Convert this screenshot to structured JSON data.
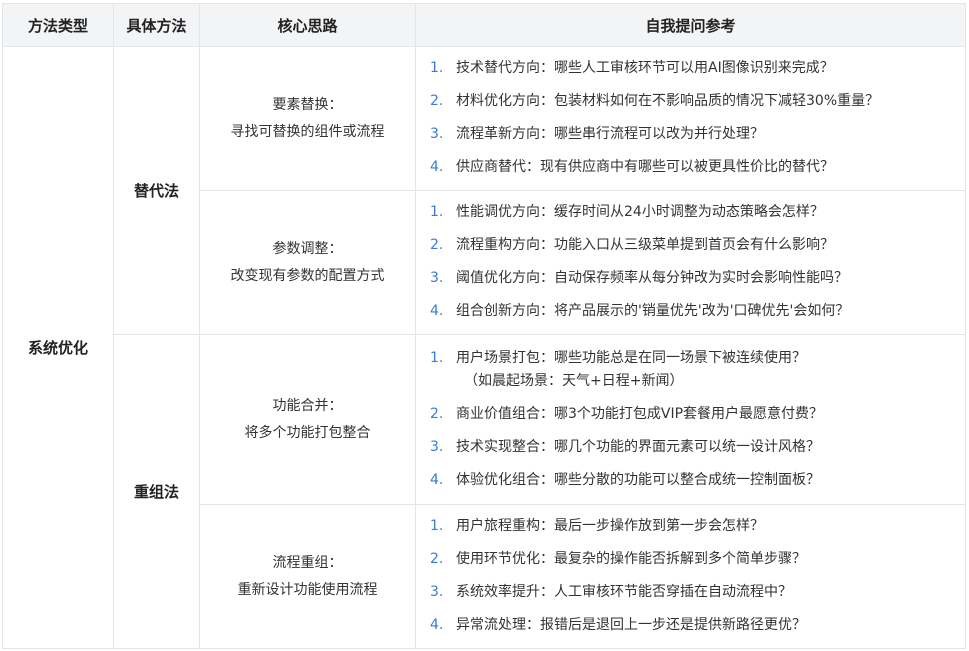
{
  "headers": [
    "方法类型",
    "具体方法",
    "核心思路",
    "自我提问参考"
  ],
  "category": "系统优化",
  "methods": [
    {
      "name": "替代法",
      "subs": [
        {
          "idea_title": "要素替换：",
          "idea_desc": "寻找可替换的组件或流程",
          "questions": [
            {
              "num": "1.",
              "text": "技术替代方向：哪些人工审核环节可以用AI图像识别来完成？"
            },
            {
              "num": "2.",
              "text": "材料优化方向：包装材料如何在不影响品质的情况下减轻30%重量？"
            },
            {
              "num": "3.",
              "text": "流程革新方向：哪些串行流程可以改为并行处理？"
            },
            {
              "num": "4.",
              "text": "供应商替代：现有供应商中有哪些可以被更具性价比的替代？"
            }
          ]
        },
        {
          "idea_title": "参数调整：",
          "idea_desc": "改变现有参数的配置方式",
          "questions": [
            {
              "num": "1.",
              "text": "性能调优方向：缓存时间从24小时调整为动态策略会怎样？"
            },
            {
              "num": "2.",
              "text": "流程重构方向：功能入口从三级菜单提到首页会有什么影响？"
            },
            {
              "num": "3.",
              "text": "阈值优化方向：自动保存频率从每分钟改为实时会影响性能吗？"
            },
            {
              "num": "4.",
              "text": "组合创新方向：将产品展示的'销量优先'改为'口碑优先'会如何？"
            }
          ]
        }
      ]
    },
    {
      "name": "重组法",
      "subs": [
        {
          "idea_title": "功能合并：",
          "idea_desc": "将多个功能打包整合",
          "questions": [
            {
              "num": "1.",
              "text": "用户场景打包：哪些功能总是在同一场景下被连续使用？",
              "sub": "（如晨起场景：天气+日程+新闻）"
            },
            {
              "num": "2.",
              "text": "商业价值组合：哪3个功能打包成VIP套餐用户最愿意付费？"
            },
            {
              "num": "3.",
              "text": "技术实现整合：哪几个功能的界面元素可以统一设计风格？"
            },
            {
              "num": "4.",
              "text": "体验优化组合：哪些分散的功能可以整合成统一控制面板？"
            }
          ]
        },
        {
          "idea_title": "流程重组：",
          "idea_desc": "重新设计功能使用流程",
          "questions": [
            {
              "num": "1.",
              "text": "用户旅程重构：最后一步操作放到第一步会怎样？"
            },
            {
              "num": "2.",
              "text": "使用环节优化：最复杂的操作能否拆解到多个简单步骤？"
            },
            {
              "num": "3.",
              "text": "系统效率提升：人工审核环节能否穿插在自动流程中？"
            },
            {
              "num": "4.",
              "text": "异常流处理：报错后是退回上一步还是提供新路径更优？"
            }
          ]
        }
      ]
    }
  ]
}
